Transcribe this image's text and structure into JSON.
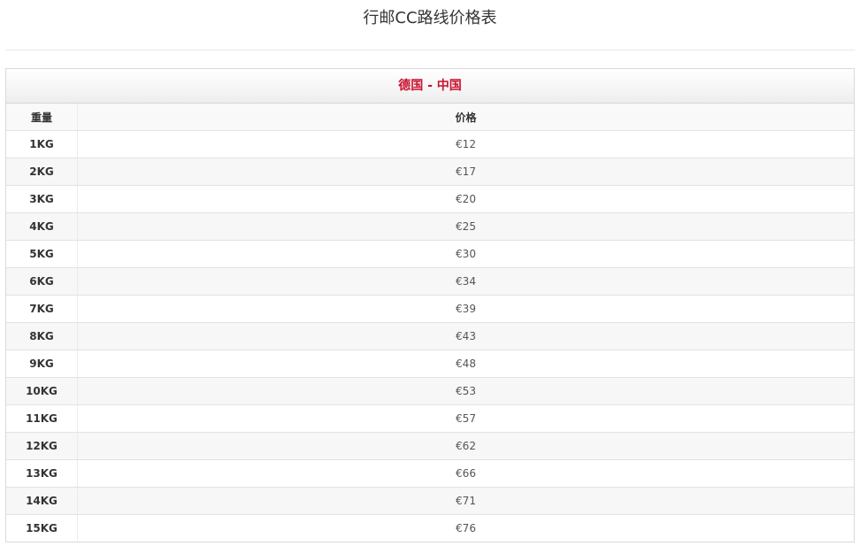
{
  "page": {
    "title": "行邮CC路线价格表"
  },
  "route": {
    "title": "德国 - 中国"
  },
  "table": {
    "headers": {
      "weight": "重量",
      "price": "价格"
    },
    "rows": [
      {
        "weight": "1KG",
        "price": "€12"
      },
      {
        "weight": "2KG",
        "price": "€17"
      },
      {
        "weight": "3KG",
        "price": "€20"
      },
      {
        "weight": "4KG",
        "price": "€25"
      },
      {
        "weight": "5KG",
        "price": "€30"
      },
      {
        "weight": "6KG",
        "price": "€34"
      },
      {
        "weight": "7KG",
        "price": "€39"
      },
      {
        "weight": "8KG",
        "price": "€43"
      },
      {
        "weight": "9KG",
        "price": "€48"
      },
      {
        "weight": "10KG",
        "price": "€53"
      },
      {
        "weight": "11KG",
        "price": "€57"
      },
      {
        "weight": "12KG",
        "price": "€62"
      },
      {
        "weight": "13KG",
        "price": "€66"
      },
      {
        "weight": "14KG",
        "price": "€71"
      },
      {
        "weight": "15KG",
        "price": "€76"
      }
    ]
  },
  "colors": {
    "route_title": "#c8102e",
    "text": "#333333",
    "border": "#d9d9d9",
    "zebra_row": "#f7f7f7"
  }
}
